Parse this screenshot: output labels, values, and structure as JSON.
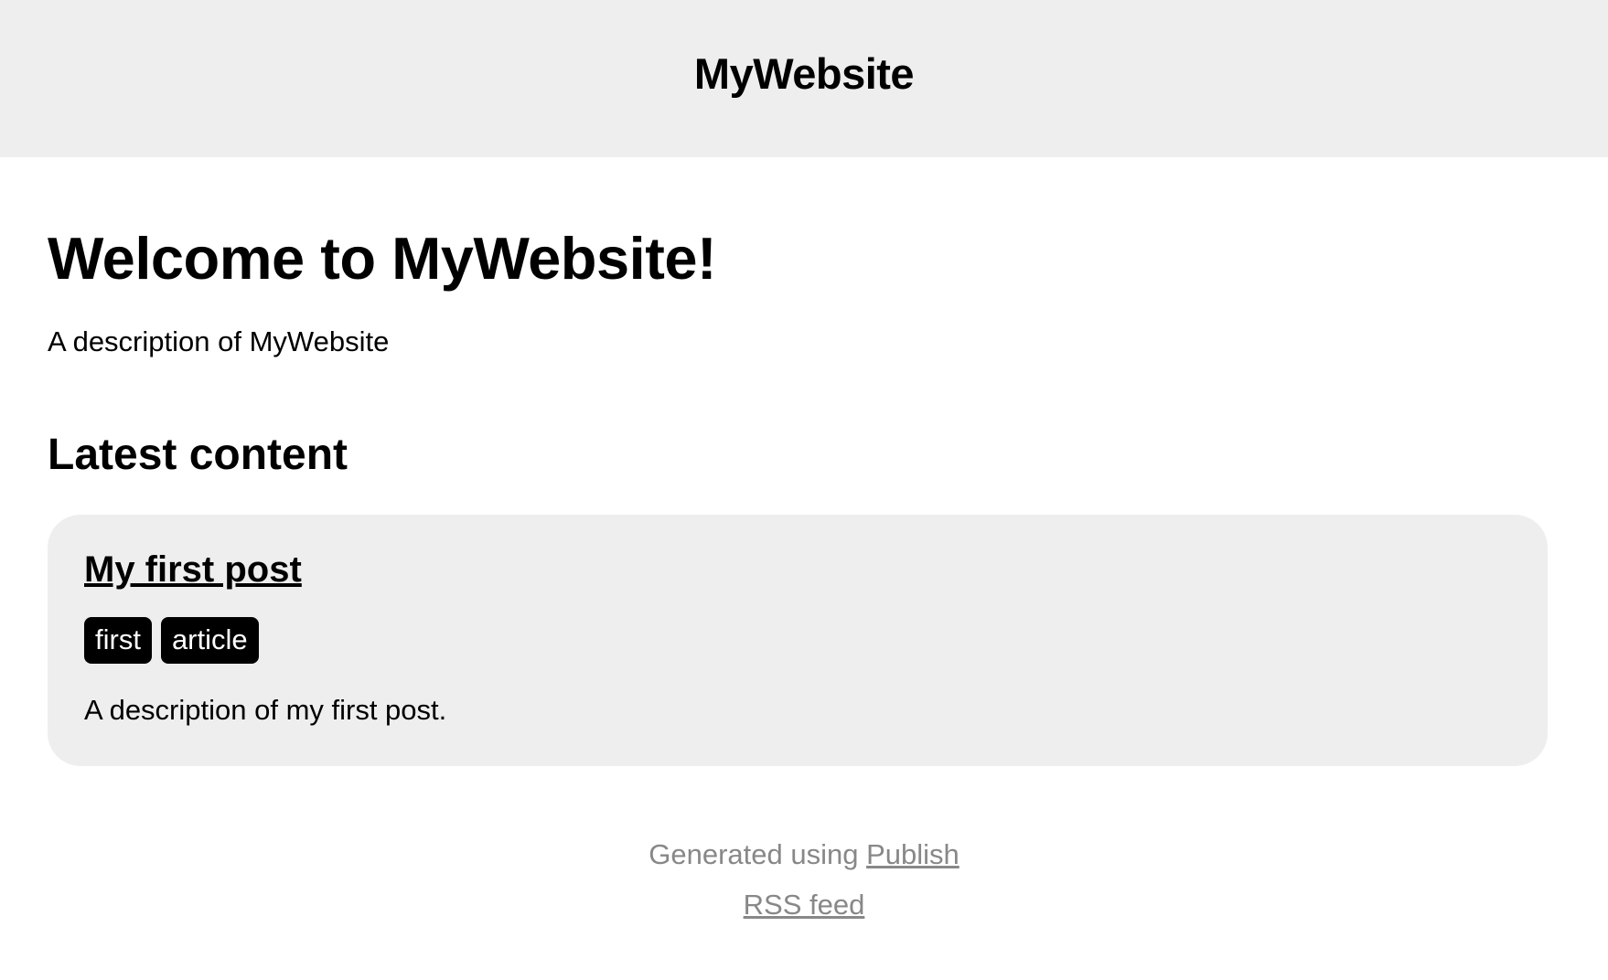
{
  "header": {
    "site_title": "MyWebsite"
  },
  "main": {
    "welcome_heading": "Welcome to MyWebsite!",
    "site_description": "A description of MyWebsite",
    "latest_heading": "Latest content",
    "posts": [
      {
        "title": "My first post",
        "tags": [
          "first",
          "article"
        ],
        "description": "A description of my first post."
      }
    ]
  },
  "footer": {
    "generated_prefix": "Generated using ",
    "publish_link": "Publish",
    "rss_link": "RSS feed"
  },
  "colors": {
    "header_background": "#eeeeee",
    "card_background": "#eeeeee",
    "tag_background": "#000000",
    "footer_text": "#888888"
  }
}
